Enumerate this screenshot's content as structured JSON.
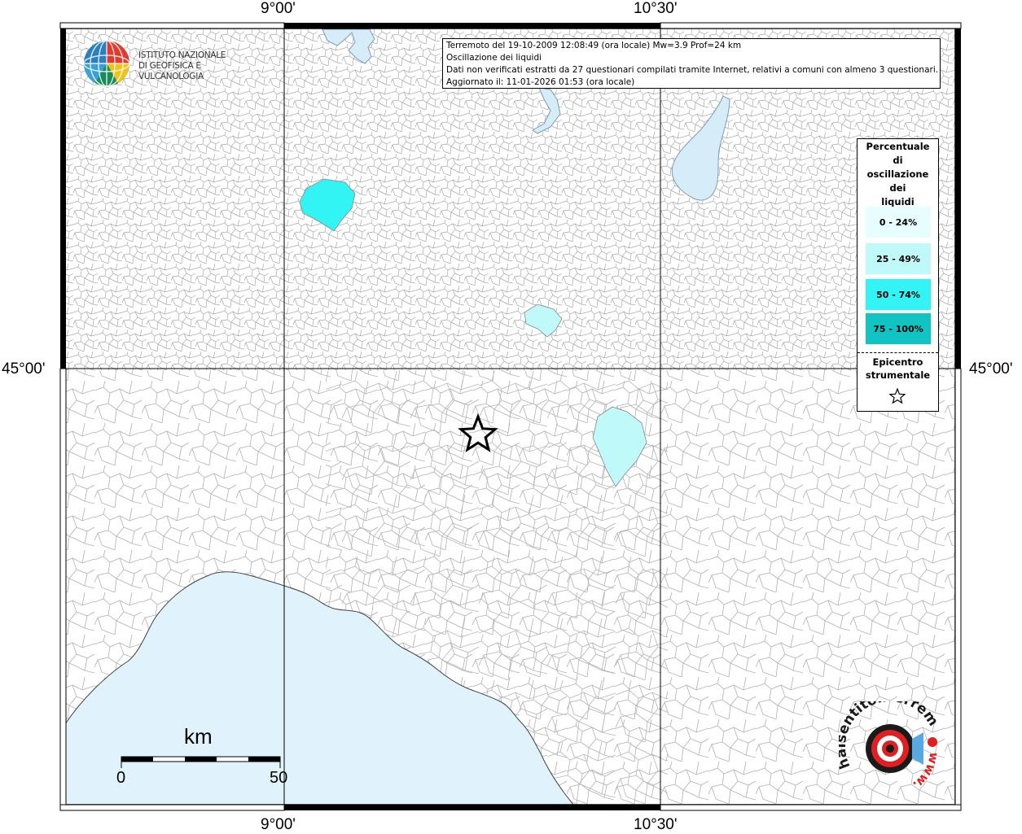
{
  "info": {
    "line1": "Terremoto del 19-10-2009 12:08:49 (ora locale) Mw=3.9 Prof=24 km",
    "line2": "Oscillazione dei liquidi",
    "line3": "Dati non verificati estratti da 27 questionari compilati tramite Internet, relativi a comuni con almeno 3 questionari.",
    "line4": "Aggiornato il: 11-01-2026 01:53 (ora locale)"
  },
  "coords": {
    "top_left": "9°00'",
    "top_right": "10°30'",
    "bottom_left": "9°00'",
    "bottom_right": "10°30'",
    "left_mid": "45°00'",
    "right_mid": "45°00'"
  },
  "legend": {
    "title_lines": [
      "Percentuale",
      "di",
      "oscillazione",
      "dei",
      "liquidi"
    ],
    "classes": [
      {
        "label": "0 - 24%",
        "color": "#e8fdfd"
      },
      {
        "label": "25 - 49%",
        "color": "#bff9fa"
      },
      {
        "label": "50 - 74%",
        "color": "#33f4f4"
      },
      {
        "label": "75 - 100%",
        "color": "#10c4c4"
      }
    ],
    "epicenter_lines": [
      "Epicentro",
      "strumentale"
    ]
  },
  "logo": {
    "line1": "ISTITUTO NAZIONALE",
    "line2": "DI GEOFISICA E VULCANOLOGIA"
  },
  "scale": {
    "title": "km",
    "min_label": "0",
    "max_label": "50"
  },
  "badge": {
    "text_top": "haisentitoilterremoto.it",
    "text_bottom": "www."
  },
  "colors": {
    "sea": "#e0f2fb",
    "lake": "#d6ecf8",
    "boundary": "#a8a8a8",
    "grid": "#000000"
  }
}
